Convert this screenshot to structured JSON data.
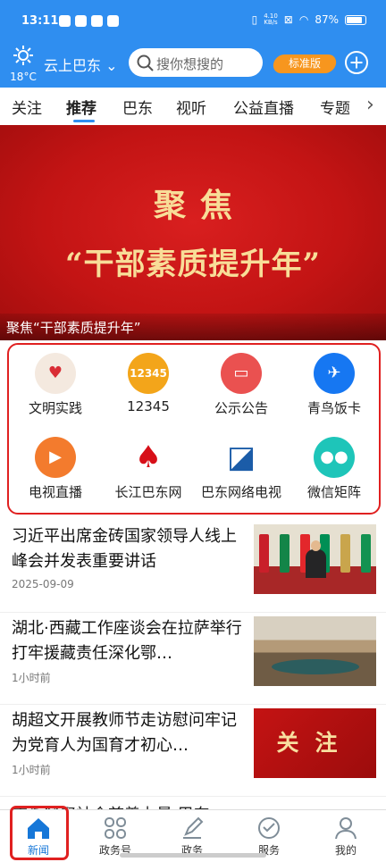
{
  "status": {
    "time": "13:11",
    "speed_value": "4.10",
    "speed_unit": "KB/s",
    "battery": "87%"
  },
  "header": {
    "temperature": "18°C",
    "location": "云上巴东",
    "search_placeholder": "搜你想搜的",
    "version": "标准版"
  },
  "tabs": [
    "关注",
    "推荐",
    "巴东",
    "视听",
    "公益直播",
    "专题"
  ],
  "banner": {
    "title_line_1": "聚焦",
    "title_line_2": "“干部素质提升年”",
    "caption": "聚焦“干部素质提升年”"
  },
  "services": [
    {
      "label": "文明实践",
      "icon": "heart-icon",
      "color": "#f4e9df"
    },
    {
      "label": "12345",
      "icon": "hotline-icon",
      "color": "#f3a51a"
    },
    {
      "label": "公示公告",
      "icon": "notice-icon",
      "color": "#ea5150"
    },
    {
      "label": "青鸟饭卡",
      "icon": "bird-icon",
      "color": "#1677f2"
    },
    {
      "label": "电视直播",
      "icon": "tv-camera-icon",
      "color": "#f37b2d"
    },
    {
      "label": "长江巴东网",
      "icon": "yangtze-logo-icon",
      "color": "#ffffff"
    },
    {
      "label": "巴东网络电视",
      "icon": "network-tv-icon",
      "color": "#ffffff"
    },
    {
      "label": "微信矩阵",
      "icon": "wechat-icon",
      "color": "#1ec5b9"
    }
  ],
  "news": [
    {
      "title": "习近平出席金砖国家领导人线上峰会并发表重要讲话",
      "meta": "2025-09-09"
    },
    {
      "title": "湖北·西藏工作座谈会在拉萨举行 打牢援藏责任深化鄂…",
      "meta": "1小时前"
    },
    {
      "title": "胡超文开展教师节走访慰问牢记为党育人为国育才初心…",
      "meta": "1小时前",
      "thumb_text": "关注"
    }
  ],
  "partial_news": "广泛凝聚社会慈善力量 巴东",
  "bottom_nav": [
    "新闻",
    "政务号",
    "政务",
    "服务",
    "我的"
  ]
}
